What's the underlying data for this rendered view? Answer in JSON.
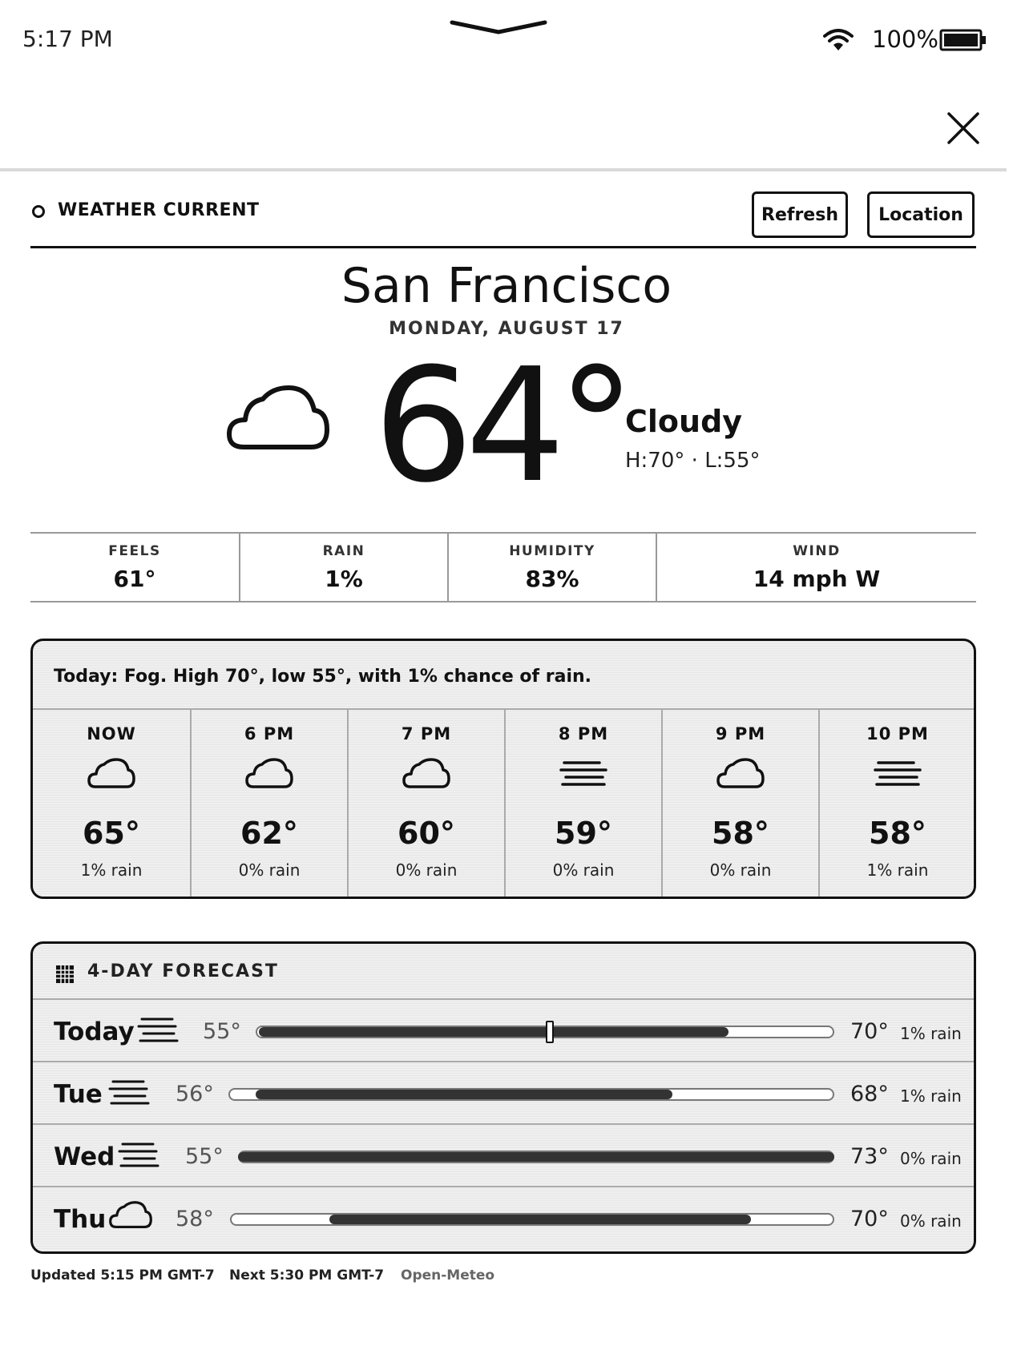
{
  "status_bar": {
    "time": "5:17 PM",
    "battery": "100%",
    "wifi_icon": "wifi-icon",
    "battery_icon": "battery-full-icon"
  },
  "app": {
    "title": "WEATHER CURRENT",
    "refresh_label": "Refresh",
    "location_label": "Location"
  },
  "current": {
    "city": "San Francisco",
    "date": "MONDAY, AUGUST 17",
    "temp": "64°",
    "condition": "Cloudy",
    "condition_icon": "cloud-icon",
    "high_low": "H:70° · L:55°"
  },
  "stats": [
    {
      "label": "FEELS",
      "value": "61°"
    },
    {
      "label": "RAIN",
      "value": "1%"
    },
    {
      "label": "HUMIDITY",
      "value": "83%"
    },
    {
      "label": "WIND",
      "value": "14 mph W"
    }
  ],
  "hourly": {
    "summary": "Today: Fog. High 70°, low 55°, with 1% chance of rain.",
    "hours": [
      {
        "label": "NOW",
        "icon": "cloud-icon",
        "temp": "65°",
        "rain": "1% rain"
      },
      {
        "label": "6 PM",
        "icon": "cloud-icon",
        "temp": "62°",
        "rain": "0% rain"
      },
      {
        "label": "7 PM",
        "icon": "cloud-icon",
        "temp": "60°",
        "rain": "0% rain"
      },
      {
        "label": "8 PM",
        "icon": "fog-icon",
        "temp": "59°",
        "rain": "0% rain"
      },
      {
        "label": "9 PM",
        "icon": "cloud-icon",
        "temp": "58°",
        "rain": "0% rain"
      },
      {
        "label": "10 PM",
        "icon": "fog-icon",
        "temp": "58°",
        "rain": "1% rain"
      }
    ]
  },
  "daily": {
    "title": "4-DAY FORECAST",
    "days": [
      {
        "name": "Today",
        "icon": "fog-icon",
        "lo": "55°",
        "hi": "70°",
        "rain": "1% rain",
        "current_temp_marker": 64
      },
      {
        "name": "Tue",
        "icon": "fog-icon",
        "lo": "56°",
        "hi": "68°",
        "rain": "1% rain"
      },
      {
        "name": "Wed",
        "icon": "fog-icon",
        "lo": "55°",
        "hi": "73°",
        "rain": "0% rain"
      },
      {
        "name": "Thu",
        "icon": "cloud-icon",
        "lo": "58°",
        "hi": "70°",
        "rain": "0% rain"
      }
    ]
  },
  "footer": {
    "updated": "Updated 5:15 PM GMT-7",
    "next": "Next 5:30 PM GMT-7",
    "source": "Open-Meteo"
  }
}
